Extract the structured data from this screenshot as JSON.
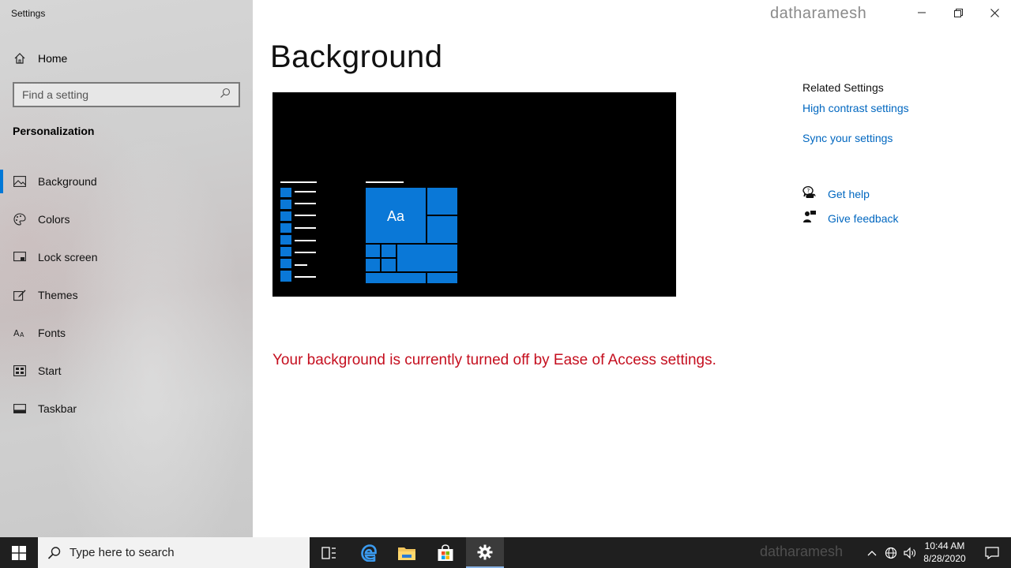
{
  "window": {
    "app_title": "Settings",
    "watermark": "datharamesh",
    "controls": {
      "minimize": "–",
      "restore": "❐",
      "close": "✕"
    }
  },
  "sidebar": {
    "home_label": "Home",
    "search_placeholder": "Find a setting",
    "section_title": "Personalization",
    "items": [
      {
        "label": "Background",
        "icon": "picture-icon",
        "active": true
      },
      {
        "label": "Colors",
        "icon": "palette-icon"
      },
      {
        "label": "Lock screen",
        "icon": "lock-screen-icon"
      },
      {
        "label": "Themes",
        "icon": "brush-icon"
      },
      {
        "label": "Fonts",
        "icon": "font-icon"
      },
      {
        "label": "Start",
        "icon": "start-icon"
      },
      {
        "label": "Taskbar",
        "icon": "taskbar-icon"
      }
    ]
  },
  "main": {
    "page_title": "Background",
    "preview_tile_text": "Aa",
    "warning": "Your background is currently turned off by Ease of Access settings."
  },
  "related": {
    "title": "Related Settings",
    "links": [
      "High contrast settings",
      "Sync your settings"
    ],
    "get_help": "Get help",
    "give_feedback": "Give feedback"
  },
  "taskbar": {
    "search_placeholder": "Type here to search",
    "watermark": "datharamesh",
    "time": "10:44 AM",
    "date": "8/28/2020"
  },
  "colors": {
    "accent": "#0078d7",
    "warning": "#c50f1f",
    "link": "#0067c0"
  }
}
